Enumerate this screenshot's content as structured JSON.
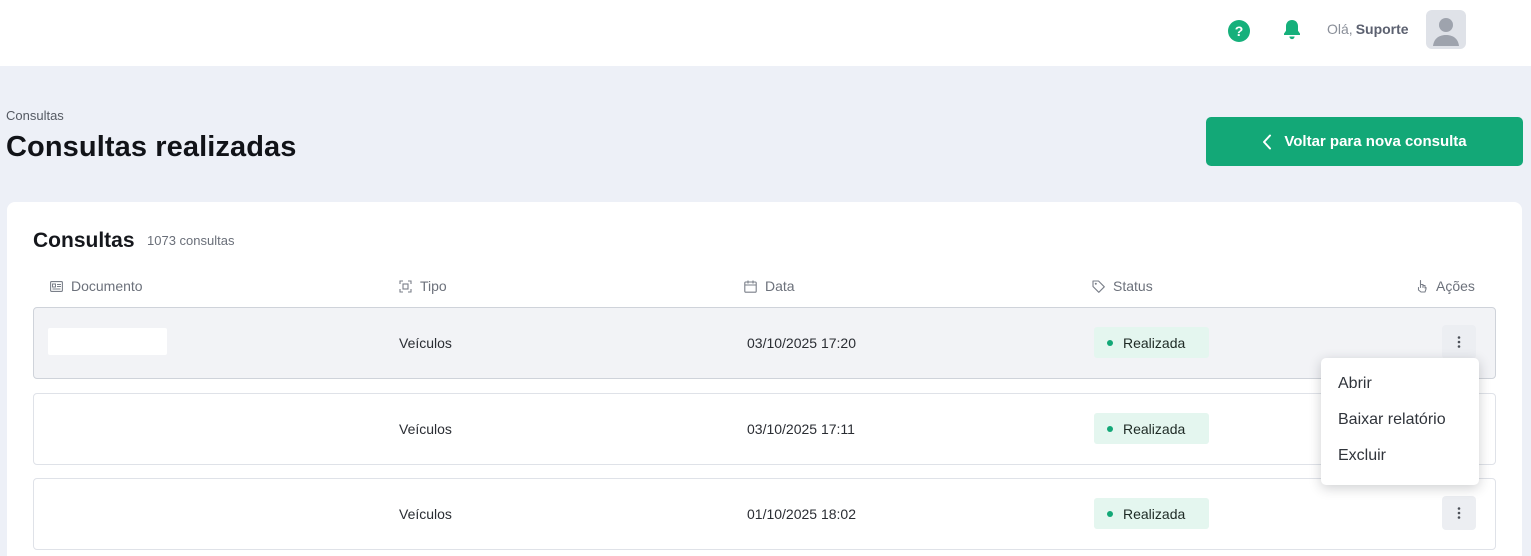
{
  "header": {
    "help_icon": "question-circle-icon",
    "bell_icon": "bell-icon",
    "greeting": "Olá,",
    "user_name": "Suporte",
    "avatar_icon": "user-avatar-icon"
  },
  "page": {
    "breadcrumb": "Consultas",
    "title": "Consultas realizadas",
    "back_button_label": "Voltar para nova consulta"
  },
  "card": {
    "title": "Consultas",
    "count": "1073 consultas"
  },
  "table": {
    "columns": {
      "documento": "Documento",
      "tipo": "Tipo",
      "data": "Data",
      "status": "Status",
      "acoes": "Ações"
    },
    "rows": [
      {
        "tipo": "Veículos",
        "data": "03/10/2025 17:20",
        "status": "Realizada"
      },
      {
        "tipo": "Veículos",
        "data": "03/10/2025 17:11",
        "status": "Realizada"
      },
      {
        "tipo": "Veículos",
        "data": "01/10/2025 18:02",
        "status": "Realizada"
      }
    ]
  },
  "action_menu": {
    "items": [
      "Abrir",
      "Baixar relatório",
      "Excluir"
    ]
  },
  "colors": {
    "accent": "#13a877",
    "status_bg": "#e4f6ef",
    "page_bg": "#edf0f7"
  }
}
